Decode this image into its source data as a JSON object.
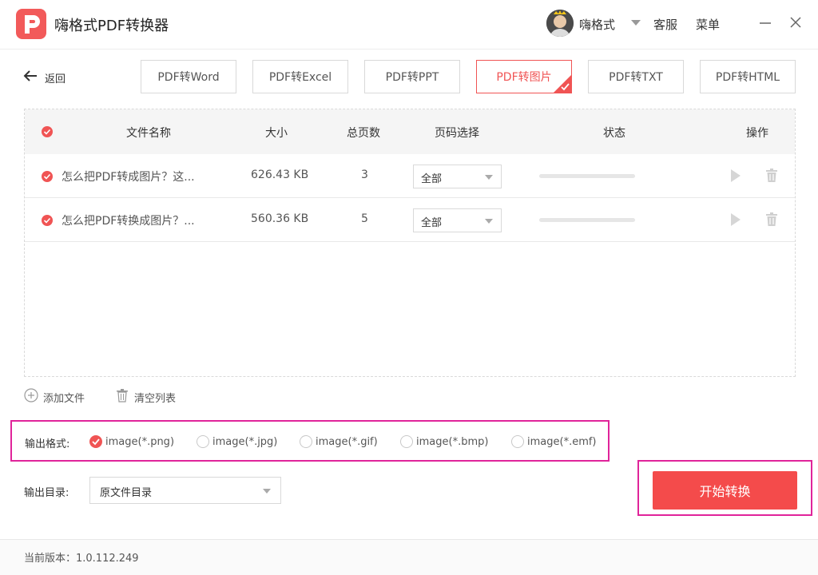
{
  "app": {
    "title": "嗨格式PDF转换器",
    "username": "嗨格式",
    "service_label": "客服",
    "menu_label": "菜单"
  },
  "nav": {
    "back_label": "返回",
    "tabs": [
      {
        "label": "PDF转Word",
        "active": false
      },
      {
        "label": "PDF转Excel",
        "active": false
      },
      {
        "label": "PDF转PPT",
        "active": false
      },
      {
        "label": "PDF转图片",
        "active": true
      },
      {
        "label": "PDF转TXT",
        "active": false
      },
      {
        "label": "PDF转HTML",
        "active": false
      }
    ]
  },
  "table": {
    "headers": {
      "name": "文件名称",
      "size": "大小",
      "pages": "总页数",
      "page_select": "页码选择",
      "status": "状态",
      "actions": "操作"
    },
    "rows": [
      {
        "name": "怎么把PDF转成图片？这...",
        "size": "626.43 KB",
        "pages": "3",
        "page_select": "全部",
        "progress": 0
      },
      {
        "name": "怎么把PDF转换成图片？...",
        "size": "560.36 KB",
        "pages": "5",
        "page_select": "全部",
        "progress": 0
      }
    ]
  },
  "tools": {
    "add_file": "添加文件",
    "clear_list": "清空列表"
  },
  "output": {
    "format_label": "输出格式:",
    "formats": [
      {
        "label": "image(*.png)",
        "selected": true
      },
      {
        "label": "image(*.jpg)",
        "selected": false
      },
      {
        "label": "image(*.gif)",
        "selected": false
      },
      {
        "label": "image(*.bmp)",
        "selected": false
      },
      {
        "label": "image(*.emf)",
        "selected": false
      }
    ],
    "dir_label": "输出目录:",
    "dir_value": "原文件目录"
  },
  "convert_button": "开始转换",
  "footer": {
    "version": "当前版本：1.0.112.249"
  },
  "colors": {
    "accent": "#f05454",
    "highlight": "#e0249a"
  }
}
